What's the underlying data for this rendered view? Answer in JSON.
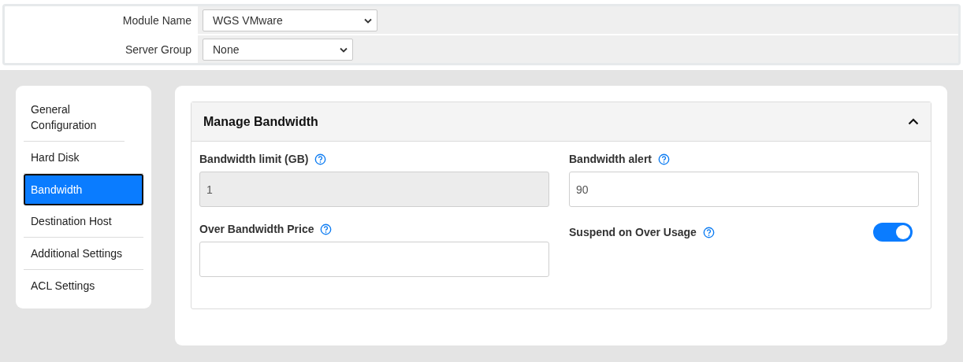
{
  "settings": [
    {
      "label": "Module Name",
      "value": "WGS VMware"
    },
    {
      "label": "Server Group",
      "value": "None"
    }
  ],
  "sidebar": {
    "items": [
      {
        "label": "General Configuration",
        "selected": false
      },
      {
        "label": "Hard Disk",
        "selected": false
      },
      {
        "label": "Bandwidth",
        "selected": true
      },
      {
        "label": "Destination Host",
        "selected": false
      },
      {
        "label": "Additional Settings",
        "selected": false
      },
      {
        "label": "ACL Settings",
        "selected": false
      }
    ]
  },
  "panel": {
    "title": "Manage Bandwidth",
    "expanded": true,
    "fields": [
      {
        "kind": "text",
        "label": "Bandwidth limit (GB)",
        "value": "1",
        "disabled": true
      },
      {
        "kind": "text",
        "label": "Bandwidth alert",
        "value": "90",
        "disabled": false
      },
      {
        "kind": "text",
        "label": "Over Bandwidth Price",
        "disabled": false
      },
      {
        "kind": "toggle",
        "label": "Suspend on Over Usage",
        "on": true
      }
    ]
  }
}
